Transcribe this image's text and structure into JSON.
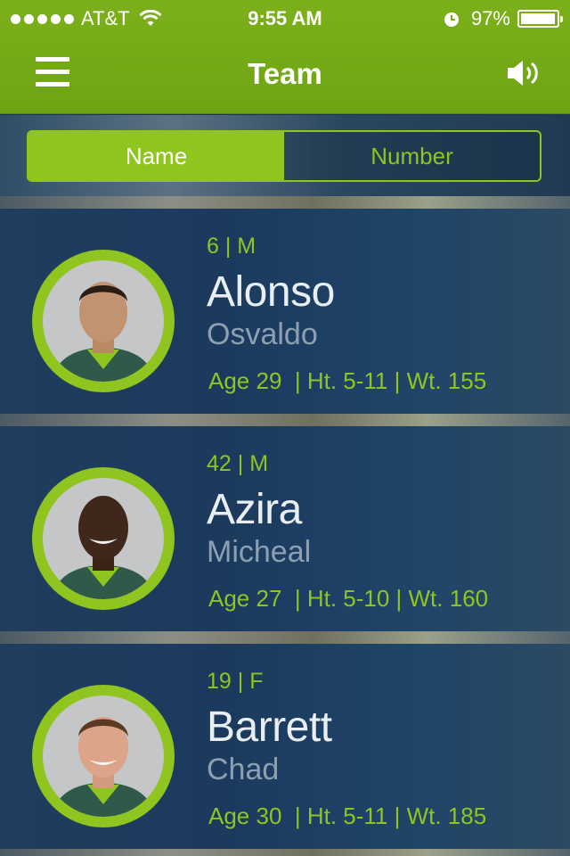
{
  "status_bar": {
    "carrier": "AT&T",
    "time": "9:55 AM",
    "battery": "97%"
  },
  "nav": {
    "title": "Team",
    "menu_icon": "hamburger-menu-icon",
    "sound_icon": "speaker-volume-icon"
  },
  "sort": {
    "options": [
      "Name",
      "Number"
    ],
    "selected": "Name"
  },
  "players": [
    {
      "meta": "6 | M",
      "last_name": "Alonso",
      "first_name": "Osvaldo",
      "stats": "Age 29  | Ht. 5-11 | Wt. 155"
    },
    {
      "meta": "42 | M",
      "last_name": "Azira",
      "first_name": "Micheal",
      "stats": "Age 27  | Ht. 5-10 | Wt. 160"
    },
    {
      "meta": "19 | F",
      "last_name": "Barrett",
      "first_name": "Chad",
      "stats": "Age 30  | Ht. 5-11 | Wt. 185"
    }
  ],
  "colors": {
    "accent": "#8fc51e",
    "header": "#74aa17"
  }
}
